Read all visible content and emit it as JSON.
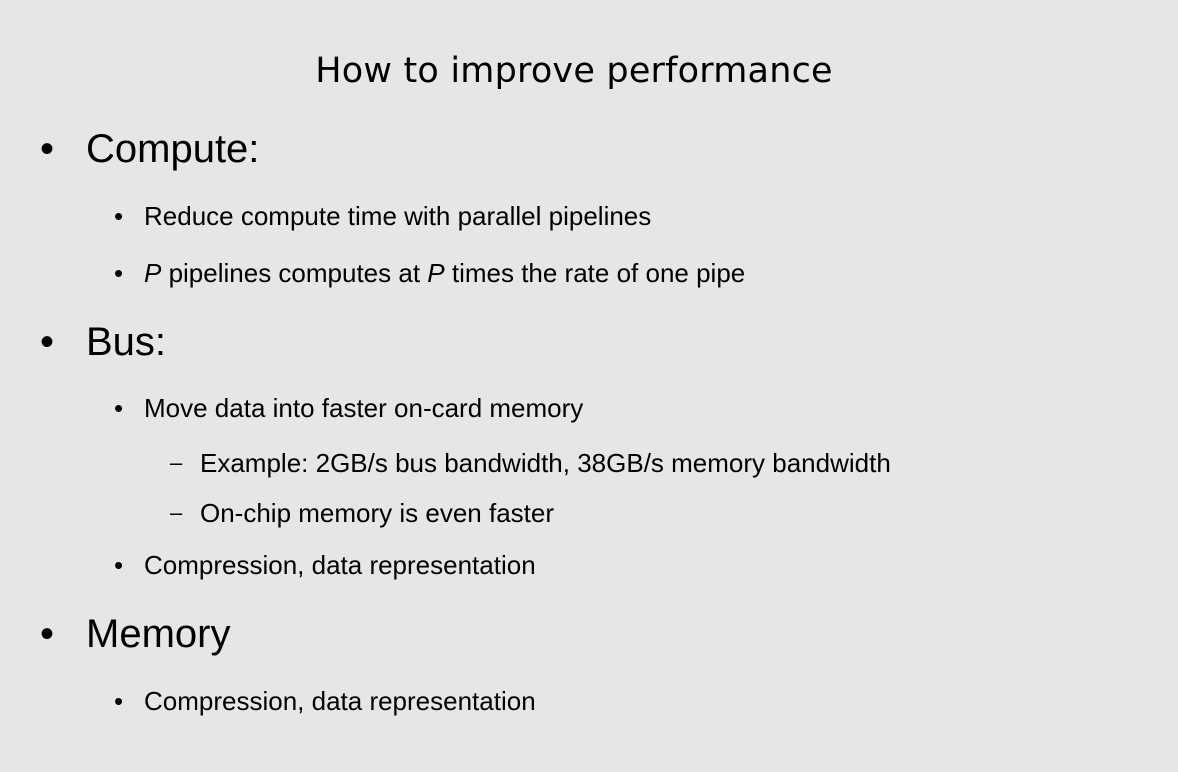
{
  "slide": {
    "title": "How to improve performance",
    "bullet_symbol": "•",
    "dash_symbol": "–",
    "items": [
      {
        "text": "Compute:"
      },
      {
        "text": "Reduce compute time with parallel pipelines"
      },
      {
        "var1": "P",
        "mid": " pipelines computes at ",
        "var2": "P",
        "end": " times the rate of one pipe"
      },
      {
        "text": "Bus:"
      },
      {
        "text": "Move data into faster on-card memory"
      },
      {
        "text": "Example: 2GB/s bus bandwidth, 38GB/s memory bandwidth"
      },
      {
        "text": "On-chip memory is even faster"
      },
      {
        "text": "Compression, data representation"
      },
      {
        "text": "Memory"
      },
      {
        "text": "Compression, data representation"
      }
    ]
  }
}
